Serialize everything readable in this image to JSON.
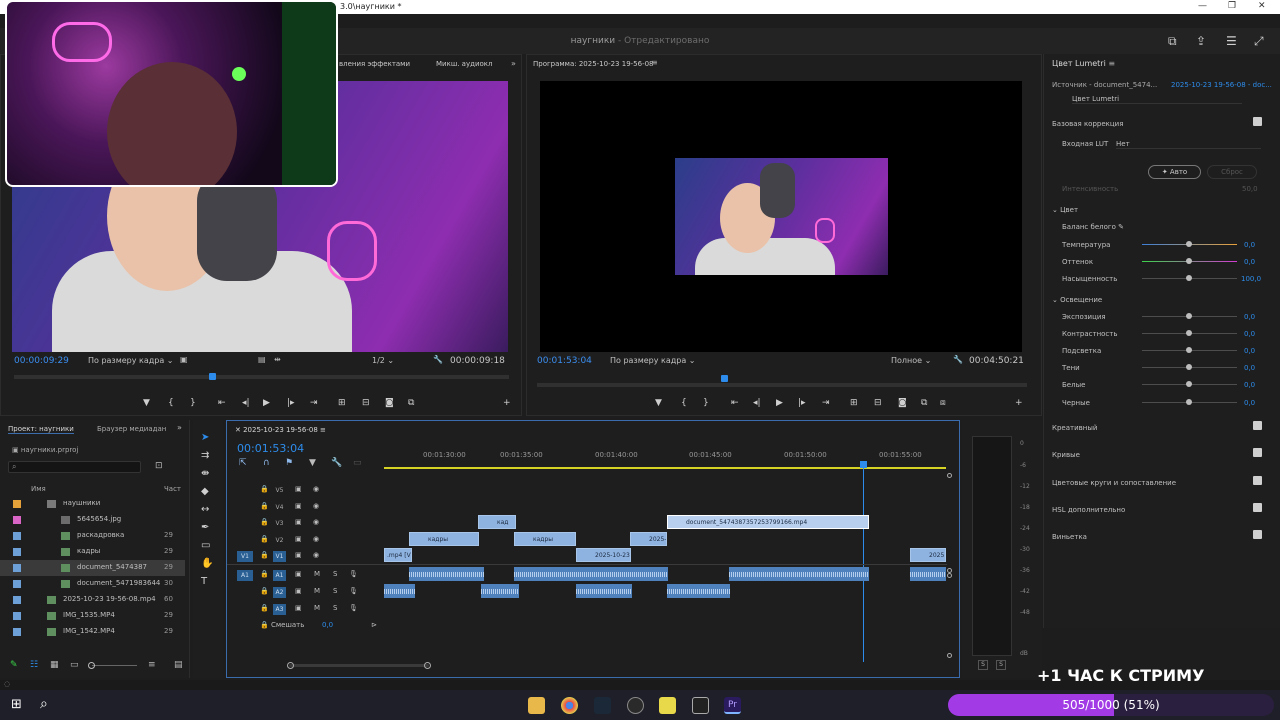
{
  "window": {
    "title": "3.0\\наугники *",
    "controls": [
      "—",
      "❐",
      "✕"
    ]
  },
  "header": {
    "title": "наугники",
    "subtitle": "- Отредактировано"
  },
  "source_monitor": {
    "tabs": [
      "вления эффектами",
      "Микш. аудиокл"
    ],
    "timecode": "00:00:09:29",
    "fit": "По размеру кадра",
    "resolution": "1/2",
    "duration": "00:00:09:18"
  },
  "program_monitor": {
    "title": "Программа: 2025-10-23 19-56-08",
    "timecode": "00:01:53:04",
    "fit": "По размеру кадра",
    "quality": "Полное",
    "duration": "00:04:50:21"
  },
  "lumetri": {
    "title": "Цвет Lumetri",
    "source": "Источник - document_5474...",
    "sequence": "2025-10-23 19-56-08 - doc...",
    "effect": "Цвет Lumetri",
    "basic": "Базовая коррекция",
    "input_lut_label": "Входная LUT",
    "input_lut_value": "Нет",
    "auto": "Авто",
    "reset": "Сброс",
    "intensity": "Интенсивность",
    "intensity_val": "50,0",
    "color_section": "Цвет",
    "white_balance": "Баланс белого",
    "color_rows": [
      {
        "label": "Температура",
        "value": "0,0"
      },
      {
        "label": "Оттенок",
        "value": "0,0"
      },
      {
        "label": "Насыщенность",
        "value": "100,0"
      }
    ],
    "light_section": "Освещение",
    "light_rows": [
      {
        "label": "Экспозиция",
        "value": "0,0"
      },
      {
        "label": "Контрастность",
        "value": "0,0"
      },
      {
        "label": "Подсветка",
        "value": "0,0"
      },
      {
        "label": "Тени",
        "value": "0,0"
      },
      {
        "label": "Белые",
        "value": "0,0"
      },
      {
        "label": "Черные",
        "value": "0,0"
      }
    ],
    "sections": [
      "Креативный",
      "Кривые",
      "Цветовые круги и сопоставление",
      "HSL дополнительно",
      "Виньетка"
    ]
  },
  "project": {
    "tabs": [
      "Проект: наугники",
      "Браузер медиадан"
    ],
    "file": "наугники.prproj",
    "col_name": "Имя",
    "col_rate": "Част",
    "items": [
      {
        "name": "наушники",
        "dur": "",
        "color": "#e5a23b"
      },
      {
        "name": "5645654.jpg",
        "dur": "",
        "color": "#d966c7"
      },
      {
        "name": "раскадровка",
        "dur": "29",
        "color": "#6ea0d8"
      },
      {
        "name": "кадры",
        "dur": "29",
        "color": "#6ea0d8"
      },
      {
        "name": "document_5474387",
        "dur": "29",
        "color": "#6ea0d8"
      },
      {
        "name": "document_5471983644",
        "dur": "30",
        "color": "#6ea0d8"
      },
      {
        "name": "2025-10-23 19-56-08.mp4",
        "dur": "60",
        "color": "#6ea0d8"
      },
      {
        "name": "IMG_1535.MP4",
        "dur": "29",
        "color": "#6ea0d8"
      },
      {
        "name": "IMG_1542.MP4",
        "dur": "29",
        "color": "#6ea0d8"
      }
    ]
  },
  "timeline": {
    "seq_name": "2025-10-23 19-56-08",
    "timecode": "00:01:53:04",
    "ruler": [
      "00:01:30:00",
      "00:01:35:00",
      "00:01:40:00",
      "00:01:45:00",
      "00:01:50:00",
      "00:01:55:00"
    ],
    "video_tracks": [
      "V5",
      "V4",
      "V3",
      "V2",
      "V1"
    ],
    "audio_tracks": [
      "A1",
      "A2",
      "A3"
    ],
    "mix_label": "Смешать",
    "mix_value": "0,0",
    "clips": {
      "v3a": "кад",
      "v3b": "document_547438735725379916​6.mp4",
      "v2a": "кадры",
      "v2b": "кадры",
      "v2c": "2025-",
      "v1a": ".mp4 [V]",
      "v1b": "2025-10-23 1",
      "v1c": "2025"
    },
    "meter_labels": [
      "0",
      "-6",
      "-12",
      "-18",
      "-24",
      "-30",
      "-36",
      "-42",
      "-48",
      "dB"
    ]
  },
  "overlay": {
    "stream_text": "+1 ЧАС К СТРИМУ",
    "progress_text": "505/1000 (51%)",
    "progress_fraction": 0.51
  }
}
